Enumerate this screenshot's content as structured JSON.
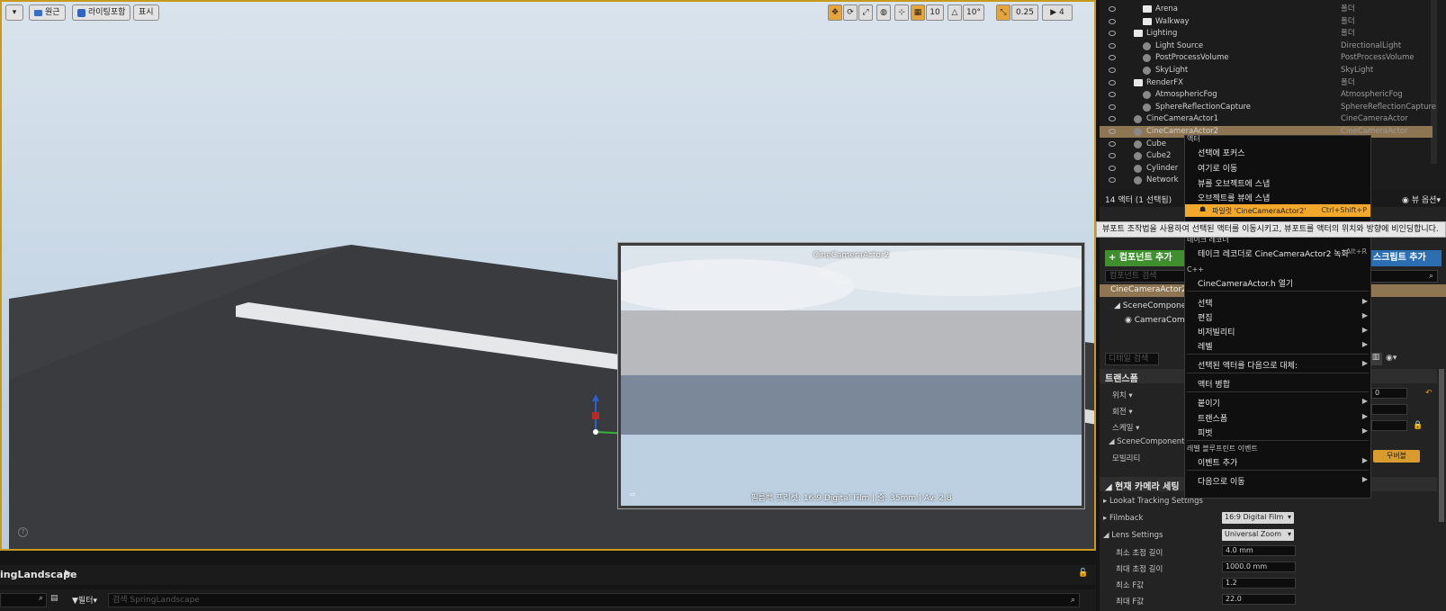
{
  "viewport": {
    "perspective_label": "원근",
    "lighting_label": "라이팅포함",
    "show_label": "표시",
    "grid_snap": "10",
    "rot_snap": "10°",
    "scale_snap": "0.25",
    "cam_speed": "4"
  },
  "preview": {
    "title": "CineCameraActor2",
    "info": "필름백 프리셋: 16:9 Digital Film | 줌: 35mm | Av: 2.8"
  },
  "content_browser": {
    "path": "ingLandscape",
    "filter_label": "필터",
    "search_placeholder": "검색 SpringLandscape"
  },
  "outliner": {
    "rows": [
      {
        "name": "Arena",
        "type": "폴더"
      },
      {
        "name": "Walkway",
        "type": "폴더"
      },
      {
        "name": "Lighting",
        "type": "폴더"
      },
      {
        "name": "Light Source",
        "type": "DirectionalLight"
      },
      {
        "name": "PostProcessVolume",
        "type": "PostProcessVolume"
      },
      {
        "name": "SkyLight",
        "type": "SkyLight"
      },
      {
        "name": "RenderFX",
        "type": "폴더"
      },
      {
        "name": "AtmosphericFog",
        "type": "AtmosphericFog"
      },
      {
        "name": "SphereReflectionCapture",
        "type": "SphereReflectionCapture"
      },
      {
        "name": "CineCameraActor1",
        "type": "CineCameraActor"
      },
      {
        "name": "CineCameraActor2",
        "type": "CineCameraActor"
      },
      {
        "name": "Cube",
        "type": "shActor"
      },
      {
        "name": "Cube2",
        "type": "shActor"
      },
      {
        "name": "Cylinder",
        "type": "shActor"
      },
      {
        "name": "Network",
        "type": "art"
      }
    ],
    "count": "14 액터 (1 선택됨)",
    "view_options": "뷰 옵션"
  },
  "details": {
    "add_component": "+ 컴포넌트 추가",
    "add_script": "스크립트 추가",
    "comp_search_placeholder": "컴포넌트 검색",
    "selected_actor": "CineCameraActor2",
    "scene_component": "SceneCompone",
    "camera_component": "CameraComp",
    "detail_search_placeholder": "디테일 검색",
    "transform_header": "트랜스폼",
    "location": "위치",
    "rotation": "회전",
    "scale": "스케일",
    "loc_value": "0",
    "scene_comp_label": "SceneComponent",
    "mobility": "모빌리티",
    "mobility_value": "무버블",
    "camera_settings_header": "현재 카메라 세팅",
    "lookat": "Lookat Tracking Settings",
    "filmback": "Filmback",
    "filmback_value": "16:9 Digital Film",
    "lens_settings": "Lens Settings",
    "lens_value": "Universal Zoom",
    "min_focal": "최소 초점 길이",
    "min_focal_value": "4.0 mm",
    "max_focal": "최대 초점 길이",
    "max_focal_value": "1000.0 mm",
    "min_f": "최소 F값",
    "min_f_value": "1.2",
    "max_f": "최대 F값",
    "max_f_value": "22.0"
  },
  "context_menu": {
    "header_actor": "액터",
    "items": {
      "focus": "선택에 포커스",
      "move_here": "여기로 이동",
      "snap_to_view": "뷰를 오브젝트에 스냅",
      "snap_obj_to_view": "오브젝트를 뷰에 스냅",
      "pilot": "파일럿 'CineCameraActor2'",
      "pilot_shortcut": "Ctrl+Shift+P",
      "take_recorder_header": "테이크 레코더",
      "record": "테이크 레코더로 CineCameraActor2 녹화",
      "record_shortcut": "Alt+R",
      "cpp_header": "C++",
      "open_h": "CineCameraActor.h 열기",
      "select": "선택",
      "edit": "편집",
      "visibility": "비저빌리티",
      "level": "레벨",
      "replace": "선택된 액터를 다음으로 대체:",
      "merge": "액터 병합",
      "attach": "붙이기",
      "transform": "트랜스폼",
      "pivot": "피벗",
      "level_bp_header": "레벨 블루프린트 이벤트",
      "add_event": "이벤트 추가",
      "move_to": "다음으로 이동"
    },
    "tooltip": "뷰포트 조작법을 사용하여 선택된 액터를 이동시키고, 뷰포트를 액터의 위치와 방향에 비인딩합니다."
  }
}
